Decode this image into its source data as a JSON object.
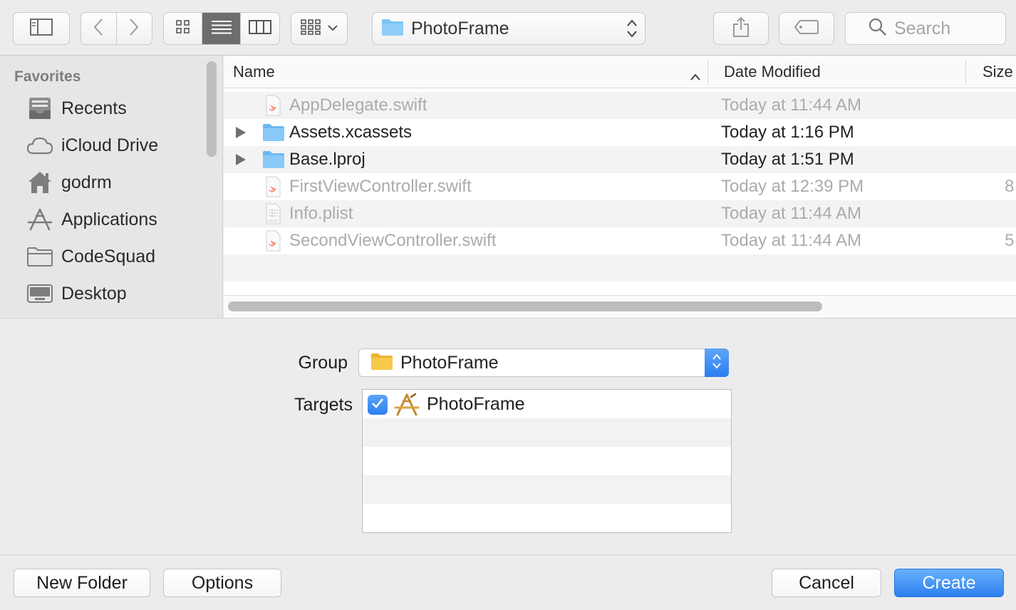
{
  "toolbar": {
    "location": "PhotoFrame",
    "search_placeholder": "Search",
    "icons": {
      "sidebar_toggle": "sidebar-icon",
      "back": "chevron-left-icon",
      "forward": "chevron-right-icon",
      "view_icons": "grid-icon",
      "view_list": "list-icon",
      "view_columns": "columns-icon",
      "group_menu": "group-grid-icon",
      "share": "share-icon",
      "tag": "tag-icon",
      "search": "search-icon"
    },
    "active_view": "list"
  },
  "sidebar": {
    "header": "Favorites",
    "items": [
      {
        "label": "Recents",
        "icon": "recents-icon"
      },
      {
        "label": "iCloud Drive",
        "icon": "cloud-icon"
      },
      {
        "label": "godrm",
        "icon": "home-icon"
      },
      {
        "label": "Applications",
        "icon": "applications-icon"
      },
      {
        "label": "CodeSquad",
        "icon": "folder-icon"
      },
      {
        "label": "Desktop",
        "icon": "desktop-icon"
      }
    ]
  },
  "filelist": {
    "columns": {
      "name": "Name",
      "date": "Date Modified",
      "size": "Size"
    },
    "sort": "ascending",
    "rows": [
      {
        "name": "AppDelegate.swift",
        "date": "Today at 11:44 AM",
        "size": "",
        "kind": "swift",
        "dimmed": true,
        "expandable": false
      },
      {
        "name": "Assets.xcassets",
        "date": "Today at 1:16 PM",
        "size": "",
        "kind": "folder",
        "dimmed": false,
        "expandable": true
      },
      {
        "name": "Base.lproj",
        "date": "Today at 1:51 PM",
        "size": "",
        "kind": "folder",
        "dimmed": false,
        "expandable": true
      },
      {
        "name": "FirstViewController.swift",
        "date": "Today at 12:39 PM",
        "size": "8",
        "kind": "swift",
        "dimmed": true,
        "expandable": false
      },
      {
        "name": "Info.plist",
        "date": "Today at 11:44 AM",
        "size": "",
        "kind": "plist",
        "dimmed": true,
        "expandable": false
      },
      {
        "name": "SecondViewController.swift",
        "date": "Today at 11:44 AM",
        "size": "5",
        "kind": "swift",
        "dimmed": true,
        "expandable": false
      }
    ]
  },
  "options": {
    "group_label": "Group",
    "group_value": "PhotoFrame",
    "targets_label": "Targets",
    "targets": [
      {
        "name": "PhotoFrame",
        "checked": true,
        "icon": "app-target-icon"
      }
    ]
  },
  "buttons": {
    "new_folder": "New Folder",
    "options": "Options",
    "cancel": "Cancel",
    "create": "Create"
  },
  "colors": {
    "accent": "#2c80f0",
    "folder_blue": "#7ec3f5",
    "folder_yellow": "#f7c948",
    "swift_orange": "#f05138"
  }
}
